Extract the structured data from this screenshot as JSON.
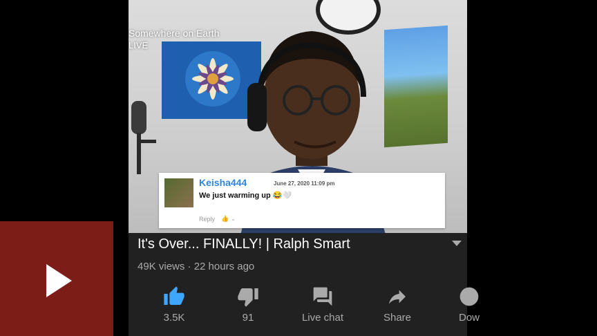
{
  "overlay": {
    "channel": "Somewhere on Earth",
    "live": "LIVE"
  },
  "comment": {
    "username": "Keisha444",
    "date": "June 27, 2020 11:09 pm",
    "text": "We just warming up 😂🤍",
    "reply": "Reply"
  },
  "video": {
    "title": "It's Over... FINALLY! | Ralph Smart",
    "meta": "49K views · 22 hours ago"
  },
  "actions": [
    {
      "label": "3.5K",
      "icon": "thumbs-up-icon",
      "active": true
    },
    {
      "label": "91",
      "icon": "thumbs-down-icon"
    },
    {
      "label": "Live chat",
      "icon": "chat-icon"
    },
    {
      "label": "Share",
      "icon": "share-icon"
    },
    {
      "label": "Dow",
      "icon": "download-icon"
    }
  ],
  "colors": {
    "accent": "#3ea6ff",
    "panel": "#212121",
    "play_overlay": "#7d1d18"
  }
}
